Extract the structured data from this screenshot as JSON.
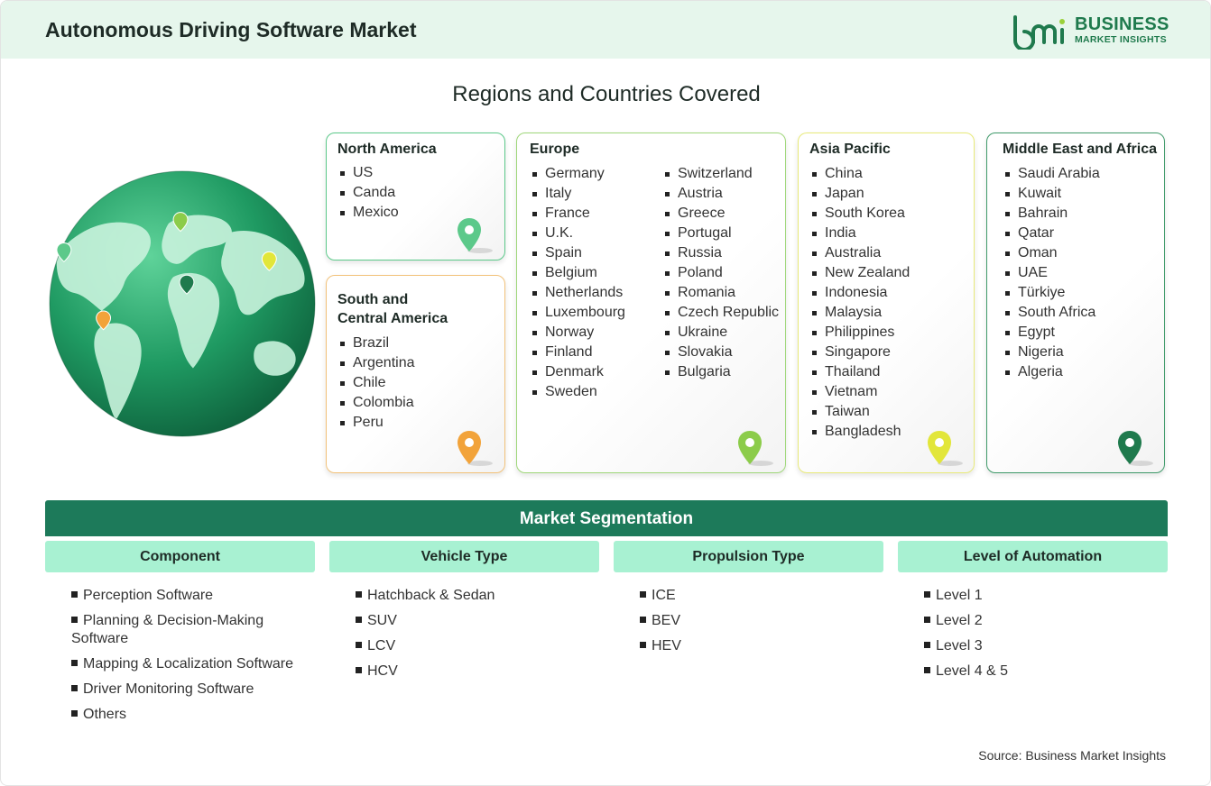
{
  "header": {
    "title": "Autonomous Driving Software Market",
    "logo_line1": "BUSINESS",
    "logo_line2": "MARKET INSIGHTS",
    "logo_mark_text": "bmi"
  },
  "regions_title": "Regions and Countries Covered",
  "regions": {
    "north_america": {
      "title": "North America",
      "items": [
        "US",
        "Canda",
        "Mexico"
      ],
      "color": "#5cc98a"
    },
    "south_central_america": {
      "title_line1": "South and",
      "title_line2": "Central America",
      "items": [
        "Brazil",
        "Argentina",
        "Chile",
        "Colombia",
        "Peru"
      ],
      "color": "#f2a33a"
    },
    "europe": {
      "title": "Europe",
      "col1": [
        "Germany",
        "Italy",
        "France",
        "U.K.",
        "Spain",
        "Belgium",
        "Netherlands",
        "Luxembourg",
        "Norway",
        "Finland",
        "Denmark",
        "Sweden"
      ],
      "col2": [
        "Switzerland",
        "Austria",
        "Greece",
        "Portugal",
        "Russia",
        "Poland",
        "Romania",
        "Czech Republic",
        "Ukraine",
        "Slovakia",
        "Bulgaria"
      ],
      "color": "#8ccc4a"
    },
    "asia_pacific": {
      "title": "Asia Pacific",
      "items": [
        "China",
        "Japan",
        "South Korea",
        "India",
        "Australia",
        "New Zealand",
        "Indonesia",
        "Malaysia",
        "Philippines",
        "Singapore",
        "Thailand",
        "Vietnam",
        "Taiwan",
        "Bangladesh"
      ],
      "color": "#e2e63a"
    },
    "middle_east_africa": {
      "title": "Middle East and Africa",
      "items": [
        "Saudi Arabia",
        "Kuwait",
        "Bahrain",
        "Qatar",
        "Oman",
        "UAE",
        "Türkiye",
        "South Africa",
        "Egypt",
        "Nigeria",
        "Algeria"
      ],
      "color": "#1f7a4d"
    }
  },
  "segmentation": {
    "title": "Market Segmentation",
    "columns": [
      {
        "heading": "Component",
        "items": [
          "Perception Software",
          "Planning & Decision-Making Software",
          "Mapping & Localization Software",
          "Driver Monitoring Software",
          "Others"
        ]
      },
      {
        "heading": "Vehicle Type",
        "items": [
          "Hatchback & Sedan",
          "SUV",
          "LCV",
          "HCV"
        ]
      },
      {
        "heading": "Propulsion Type",
        "items": [
          "ICE",
          "BEV",
          "HEV"
        ]
      },
      {
        "heading": "Level of Automation",
        "items": [
          "Level 1",
          "Level 2",
          "Level 3",
          "Level 4 & 5"
        ]
      }
    ]
  },
  "source": "Source: Business Market Insights",
  "icons": {
    "globe": "globe-icon",
    "pin": "map-pin-icon",
    "logo": "bmi-logo-icon"
  },
  "colors": {
    "header_bg": "#e6f6ec",
    "brand_green": "#1f7a4d",
    "segment_bar": "#1d7a5a",
    "segment_head": "#a8f1d2"
  }
}
